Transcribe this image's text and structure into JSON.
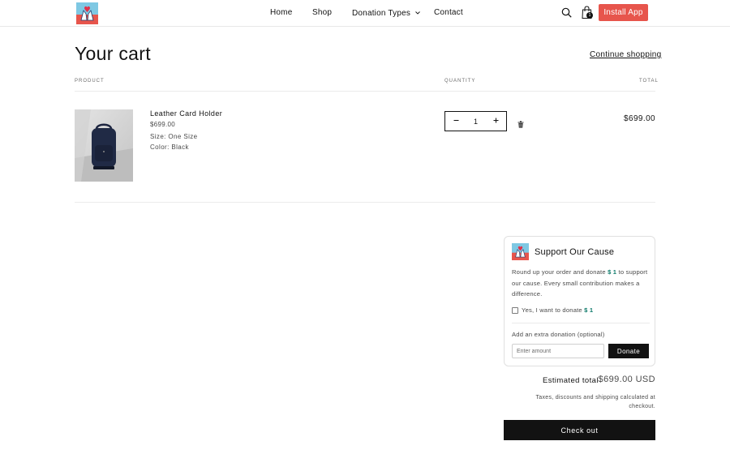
{
  "header": {
    "logo_icon": "heart-hands-logo-icon",
    "nav": {
      "home": "Home",
      "shop": "Shop",
      "donation_types": "Donation Types",
      "contact": "Contact"
    },
    "cart_count": "1",
    "install_label": "Install App",
    "accent_color": "#e7554c"
  },
  "cart": {
    "title": "Your cart",
    "continue_label": "Continue shopping",
    "columns": {
      "product": "PRODUCT",
      "quantity": "QUANTITY",
      "total": "TOTAL"
    },
    "items": [
      {
        "name": "Leather Card Holder",
        "price": "$699.00",
        "size": "Size: One Size",
        "color": "Color: Black",
        "quantity": "1",
        "total": "$699.00",
        "image_icon": "backpack-photo"
      }
    ]
  },
  "donation": {
    "title": "Support Our Cause",
    "desc_part1": "Round up your order and donate ",
    "amount": "$ 1",
    "desc_part2": " to support our cause. Every small contribution makes a difference.",
    "checkbox_label": "Yes, I want to donate ",
    "extra_label": "Add an extra donation (optional)",
    "input_placeholder": "Enter amount",
    "donate_label": "Donate",
    "amount_color": "#0d7a6a"
  },
  "summary": {
    "estimated_label": "Estimated total",
    "estimated_value": "$699.00 USD",
    "tax_note": "Taxes, discounts and shipping calculated at checkout.",
    "checkout_label": "Check out"
  }
}
